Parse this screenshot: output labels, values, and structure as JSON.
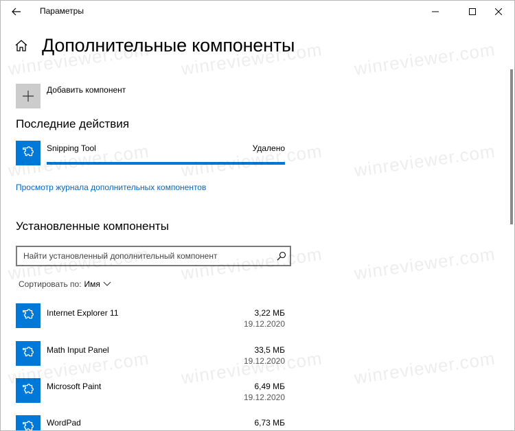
{
  "window": {
    "title": "Параметры"
  },
  "header": {
    "title": "Дополнительные компоненты"
  },
  "add_component": {
    "label": "Добавить компонент"
  },
  "recent": {
    "section_title": "Последние действия",
    "item": {
      "name": "Snipping Tool",
      "status": "Удалено",
      "progress": 1.0
    },
    "history_link": "Просмотр журнала дополнительных компонентов"
  },
  "installed": {
    "section_title": "Установленные компоненты",
    "search": {
      "placeholder": "Найти установленный дополнительный компонент"
    },
    "sort": {
      "label": "Сортировать по:",
      "value": "Имя"
    },
    "items": [
      {
        "name": "Internet Explorer 11",
        "size": "3,22 МБ",
        "date": "19.12.2020"
      },
      {
        "name": "Math Input Panel",
        "size": "33,5 МБ",
        "date": "19.12.2020"
      },
      {
        "name": "Microsoft Paint",
        "size": "6,49 МБ",
        "date": "19.12.2020"
      },
      {
        "name": "WordPad",
        "size": "6,73 МБ",
        "date": ""
      }
    ]
  },
  "watermark": {
    "text": "winreviewer.com"
  },
  "colors": {
    "accent": "#0078d7",
    "tile_gray": "#cccccc",
    "link": "#0067c0"
  }
}
